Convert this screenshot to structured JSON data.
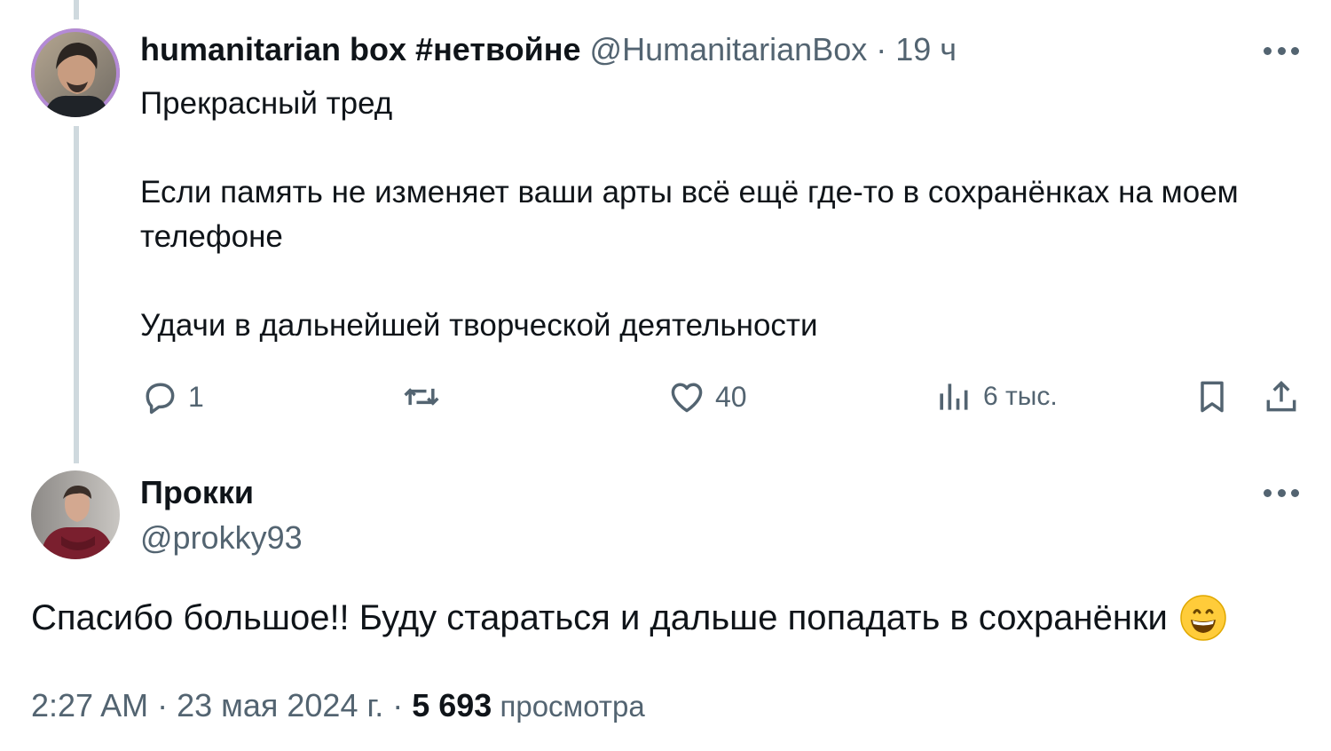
{
  "original_tweet": {
    "display_name": "humanitarian box #нетвойне",
    "handle": "@HumanitarianBox",
    "separator": "·",
    "time": "19 ч",
    "body": "Прекрасный тред\n\nЕсли память не изменяет ваши арты всё ещё где-то в сохранёнках на моем телефоне\n\nУдачи в дальнейшей творческой деятельности",
    "actions": {
      "replies": "1",
      "likes": "40",
      "views": "6 тыс."
    },
    "icons": [
      "reply-icon",
      "retweet-icon",
      "like-icon",
      "views-icon",
      "bookmark-icon",
      "share-icon",
      "more-icon"
    ]
  },
  "reply_tweet": {
    "display_name": "Прокки",
    "handle": "@prokky93",
    "text": "Спасибо большое!! Буду стараться и дальше попадать в сохранёнки",
    "emoji": "grinning-face-emoji",
    "timestamp": "2:27 AM · 23 мая 2024 г. · ",
    "views_count": "5 693",
    "views_label": " просмотра"
  },
  "colors": {
    "text_primary": "#0f1419",
    "text_secondary": "#536471",
    "thread_line": "#cfd9de"
  }
}
